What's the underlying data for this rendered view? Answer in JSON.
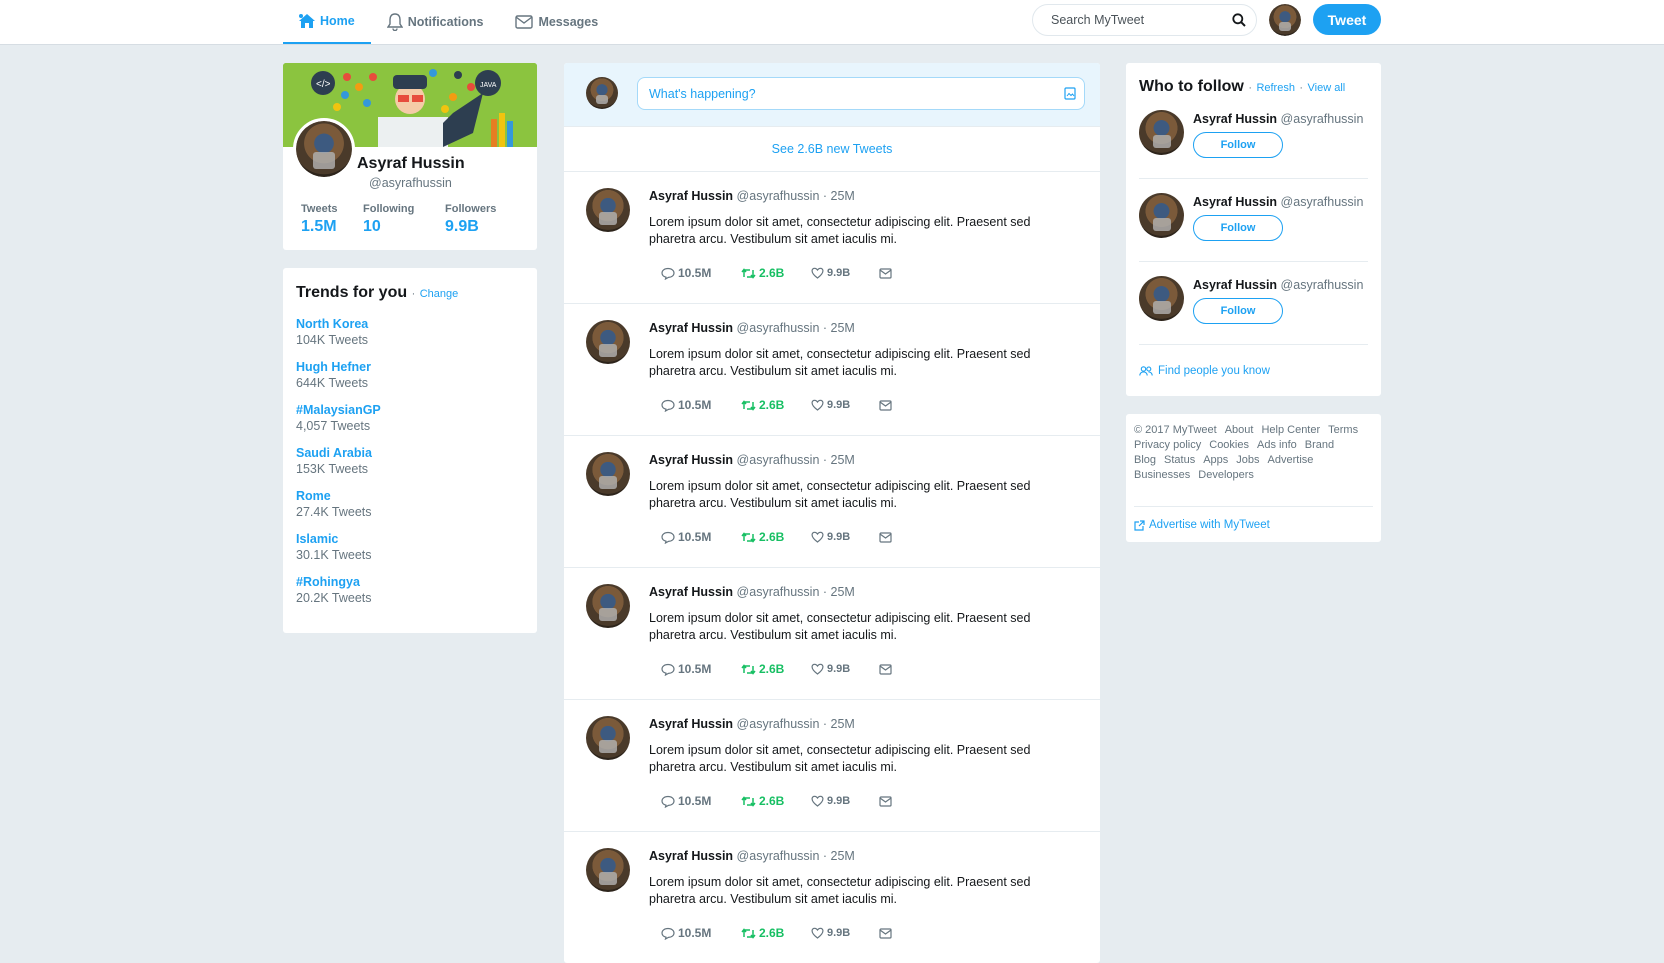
{
  "nav": {
    "home": "Home",
    "notifications": "Notifications",
    "messages": "Messages",
    "search_placeholder": "Search MyTweet",
    "tweet_button": "Tweet"
  },
  "profile": {
    "name": "Asyraf Hussin",
    "handle": "@asyrafhussin",
    "stats": [
      {
        "label": "Tweets",
        "value": "1.5M"
      },
      {
        "label": "Following",
        "value": "10"
      },
      {
        "label": "Followers",
        "value": "9.9B"
      }
    ]
  },
  "trends": {
    "title": "Trends for you",
    "sep": "·",
    "change": "Change",
    "items": [
      {
        "name": "North Korea",
        "count": "104K Tweets"
      },
      {
        "name": "Hugh Hefner",
        "count": "644K Tweets"
      },
      {
        "name": "#MalaysianGP",
        "count": "4,057 Tweets"
      },
      {
        "name": "Saudi Arabia",
        "count": "153K Tweets"
      },
      {
        "name": "Rome",
        "count": "27.4K Tweets"
      },
      {
        "name": "Islamic",
        "count": "30.1K Tweets"
      },
      {
        "name": "#Rohingya",
        "count": "20.2K Tweets"
      }
    ]
  },
  "composer": {
    "placeholder": "What's happening?",
    "new_tweets": "See 2.6B new Tweets"
  },
  "tweets": [
    {
      "name": "Asyraf Hussin",
      "meta": "@asyrafhussin · 25M",
      "text": "Lorem ipsum dolor sit amet, consectetur adipiscing elit. Praesent sed pharetra arcu. Vestibulum sit amet iaculis mi.",
      "replies": "10.5M",
      "retweets": "2.6B",
      "likes": "9.9B"
    },
    {
      "name": "Asyraf Hussin",
      "meta": "@asyrafhussin · 25M",
      "text": "Lorem ipsum dolor sit amet, consectetur adipiscing elit. Praesent sed pharetra arcu. Vestibulum sit amet iaculis mi.",
      "replies": "10.5M",
      "retweets": "2.6B",
      "likes": "9.9B"
    },
    {
      "name": "Asyraf Hussin",
      "meta": "@asyrafhussin · 25M",
      "text": "Lorem ipsum dolor sit amet, consectetur adipiscing elit. Praesent sed pharetra arcu. Vestibulum sit amet iaculis mi.",
      "replies": "10.5M",
      "retweets": "2.6B",
      "likes": "9.9B"
    },
    {
      "name": "Asyraf Hussin",
      "meta": "@asyrafhussin · 25M",
      "text": "Lorem ipsum dolor sit amet, consectetur adipiscing elit. Praesent sed pharetra arcu. Vestibulum sit amet iaculis mi.",
      "replies": "10.5M",
      "retweets": "2.6B",
      "likes": "9.9B"
    },
    {
      "name": "Asyraf Hussin",
      "meta": "@asyrafhussin · 25M",
      "text": "Lorem ipsum dolor sit amet, consectetur adipiscing elit. Praesent sed pharetra arcu. Vestibulum sit amet iaculis mi.",
      "replies": "10.5M",
      "retweets": "2.6B",
      "likes": "9.9B"
    },
    {
      "name": "Asyraf Hussin",
      "meta": "@asyrafhussin · 25M",
      "text": "Lorem ipsum dolor sit amet, consectetur adipiscing elit. Praesent sed pharetra arcu. Vestibulum sit amet iaculis mi.",
      "replies": "10.5M",
      "retweets": "2.6B",
      "likes": "9.9B"
    }
  ],
  "who_to_follow": {
    "title": "Who to follow",
    "sep": "·",
    "refresh": "Refresh",
    "view_all": "View all",
    "users": [
      {
        "name": "Asyraf Hussin",
        "handle": "@asyrafhussin",
        "button": "Follow"
      },
      {
        "name": "Asyraf Hussin",
        "handle": "@asyrafhussin",
        "button": "Follow"
      },
      {
        "name": "Asyraf Hussin",
        "handle": "@asyrafhussin",
        "button": "Follow"
      }
    ],
    "find_people": "Find people you know"
  },
  "footer": {
    "links": [
      "© 2017 MyTweet",
      "About",
      "Help Center",
      "Terms",
      "Privacy policy",
      "Cookies",
      "Ads info",
      "Brand",
      "Blog",
      "Status",
      "Apps",
      "Jobs",
      "Advertise",
      "Businesses",
      "Developers"
    ],
    "advertise": "Advertise with MyTweet"
  },
  "colors": {
    "accent": "#1da1f2",
    "retweet": "#17bf63",
    "background": "#e6ecf0",
    "banner": "#8bc43f"
  },
  "icons": [
    "home-icon",
    "bell-icon",
    "envelope-icon",
    "search-icon",
    "image-icon",
    "reply-icon",
    "retweet-icon",
    "heart-icon",
    "message-icon",
    "people-icon",
    "external-link-icon"
  ]
}
